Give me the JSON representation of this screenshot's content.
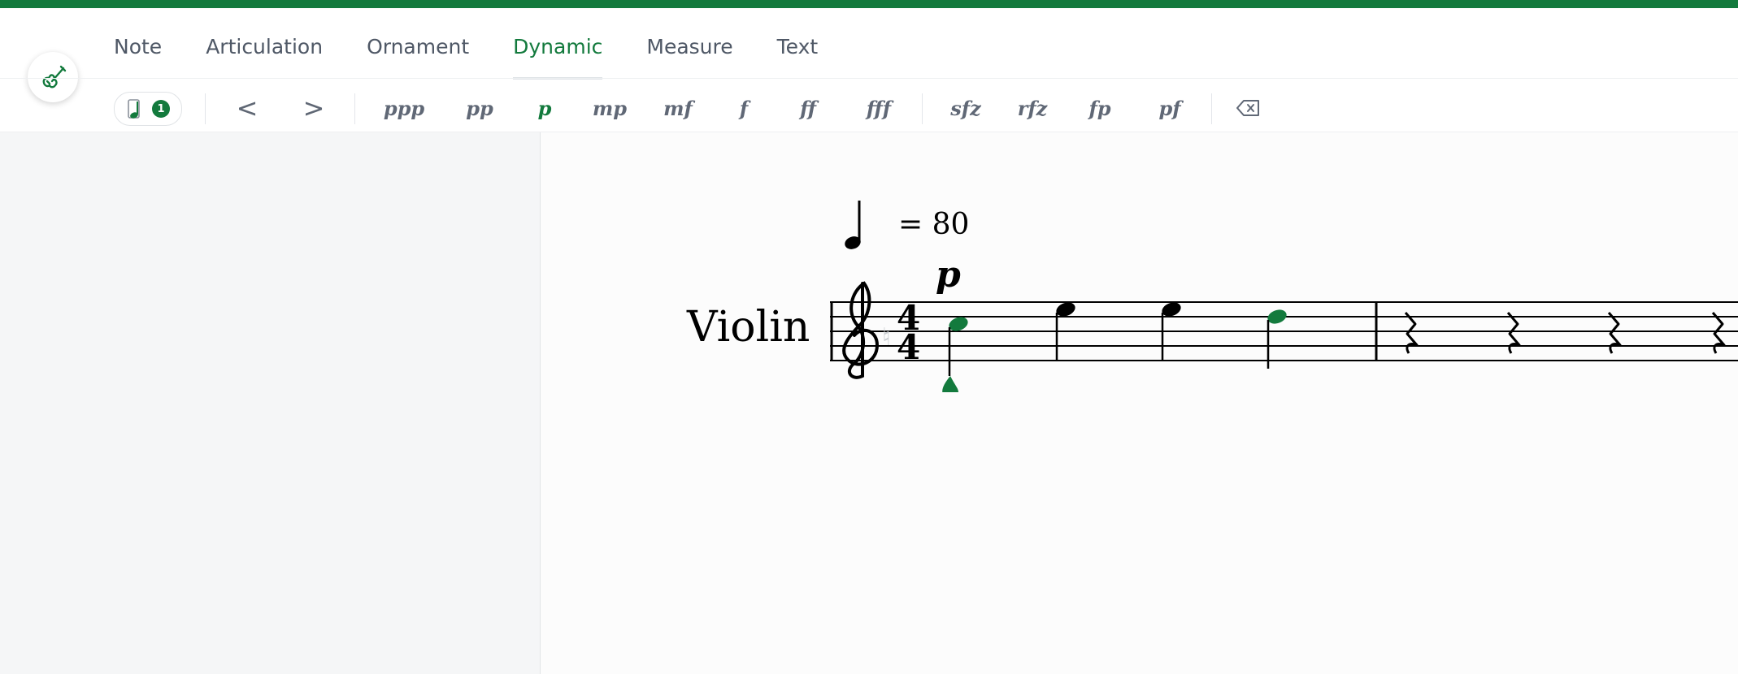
{
  "tabs": [
    {
      "label": "Note"
    },
    {
      "label": "Articulation"
    },
    {
      "label": "Ornament"
    },
    {
      "label": "Dynamic",
      "active": true
    },
    {
      "label": "Measure"
    },
    {
      "label": "Text"
    }
  ],
  "toolbar": {
    "voice_count": "1",
    "hairpins": [
      "<",
      ">"
    ],
    "dynamics": [
      "ppp",
      "pp",
      "p",
      "mp",
      "mf",
      "f",
      "ff",
      "fff"
    ],
    "accents": [
      "sfz",
      "rfz",
      "fp",
      "pf"
    ],
    "active_dynamic": "p"
  },
  "score": {
    "instrument": "Violin",
    "tempo": "= 80",
    "dynamic_mark": "p",
    "time_signature": "4/4"
  },
  "colors": {
    "accent": "#137a3d",
    "topbar": "#137a3d",
    "text": "#4f5866"
  }
}
